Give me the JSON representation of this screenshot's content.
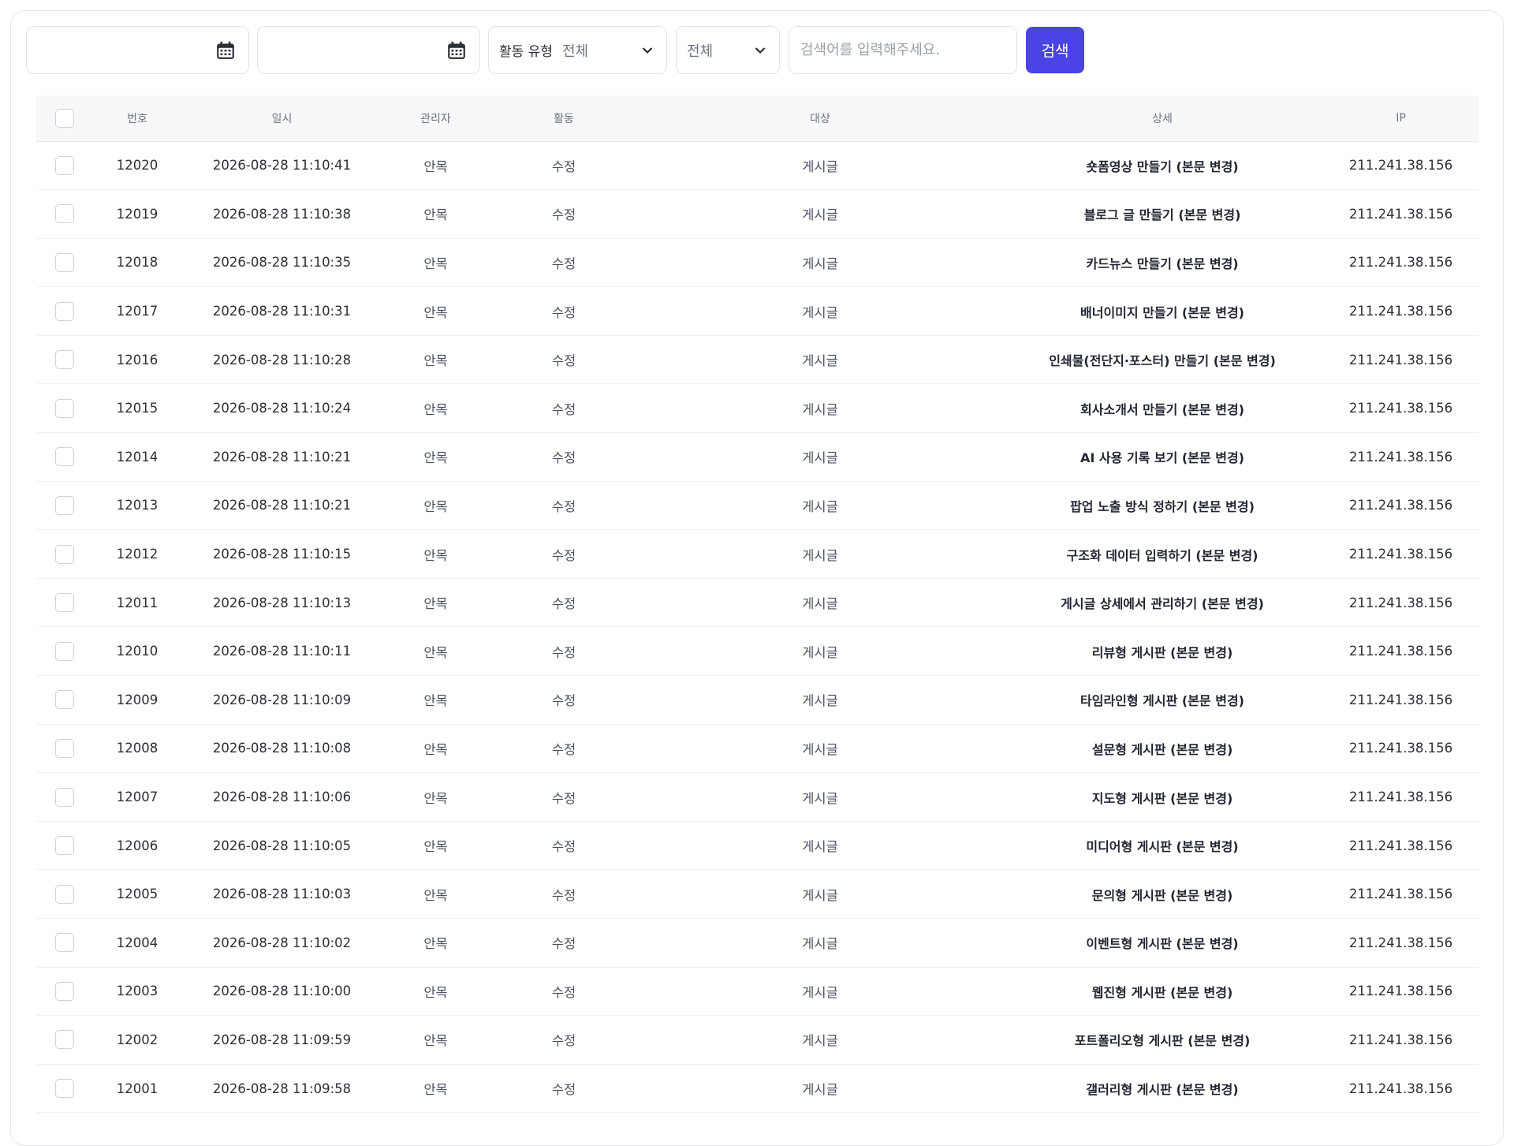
{
  "filters": {
    "start_date": "",
    "end_date": "",
    "calendar_icon": "calendar-icon",
    "activity_type_label": "활동 유형",
    "activity_type_value": "전체",
    "scope_value": "전체",
    "search_placeholder": "검색어를 입력해주세요.",
    "search_button": "검색",
    "accent_color": "#4a43e6"
  },
  "table": {
    "headers": {
      "number": "번호",
      "datetime": "일시",
      "admin": "관리자",
      "activity": "활동",
      "target": "대상",
      "detail": "상세",
      "ip": "IP"
    },
    "rows": [
      {
        "number": "12020",
        "datetime": "2026-08-28 11:10:41",
        "admin": "안목",
        "activity": "수정",
        "target": "게시글",
        "detail": "숏폼영상 만들기 (본문 변경)",
        "ip": "211.241.38.156"
      },
      {
        "number": "12019",
        "datetime": "2026-08-28 11:10:38",
        "admin": "안목",
        "activity": "수정",
        "target": "게시글",
        "detail": "블로그 글 만들기 (본문 변경)",
        "ip": "211.241.38.156"
      },
      {
        "number": "12018",
        "datetime": "2026-08-28 11:10:35",
        "admin": "안목",
        "activity": "수정",
        "target": "게시글",
        "detail": "카드뉴스 만들기 (본문 변경)",
        "ip": "211.241.38.156"
      },
      {
        "number": "12017",
        "datetime": "2026-08-28 11:10:31",
        "admin": "안목",
        "activity": "수정",
        "target": "게시글",
        "detail": "배너이미지 만들기 (본문 변경)",
        "ip": "211.241.38.156"
      },
      {
        "number": "12016",
        "datetime": "2026-08-28 11:10:28",
        "admin": "안목",
        "activity": "수정",
        "target": "게시글",
        "detail": "인쇄물(전단지·포스터) 만들기 (본문 변경)",
        "ip": "211.241.38.156"
      },
      {
        "number": "12015",
        "datetime": "2026-08-28 11:10:24",
        "admin": "안목",
        "activity": "수정",
        "target": "게시글",
        "detail": "회사소개서 만들기 (본문 변경)",
        "ip": "211.241.38.156"
      },
      {
        "number": "12014",
        "datetime": "2026-08-28 11:10:21",
        "admin": "안목",
        "activity": "수정",
        "target": "게시글",
        "detail": "AI 사용 기록 보기 (본문 변경)",
        "ip": "211.241.38.156"
      },
      {
        "number": "12013",
        "datetime": "2026-08-28 11:10:21",
        "admin": "안목",
        "activity": "수정",
        "target": "게시글",
        "detail": "팝업 노출 방식 정하기 (본문 변경)",
        "ip": "211.241.38.156"
      },
      {
        "number": "12012",
        "datetime": "2026-08-28 11:10:15",
        "admin": "안목",
        "activity": "수정",
        "target": "게시글",
        "detail": "구조화 데이터 입력하기 (본문 변경)",
        "ip": "211.241.38.156"
      },
      {
        "number": "12011",
        "datetime": "2026-08-28 11:10:13",
        "admin": "안목",
        "activity": "수정",
        "target": "게시글",
        "detail": "게시글 상세에서 관리하기 (본문 변경)",
        "ip": "211.241.38.156"
      },
      {
        "number": "12010",
        "datetime": "2026-08-28 11:10:11",
        "admin": "안목",
        "activity": "수정",
        "target": "게시글",
        "detail": "리뷰형 게시판 (본문 변경)",
        "ip": "211.241.38.156"
      },
      {
        "number": "12009",
        "datetime": "2026-08-28 11:10:09",
        "admin": "안목",
        "activity": "수정",
        "target": "게시글",
        "detail": "타임라인형 게시판 (본문 변경)",
        "ip": "211.241.38.156"
      },
      {
        "number": "12008",
        "datetime": "2026-08-28 11:10:08",
        "admin": "안목",
        "activity": "수정",
        "target": "게시글",
        "detail": "설문형 게시판 (본문 변경)",
        "ip": "211.241.38.156"
      },
      {
        "number": "12007",
        "datetime": "2026-08-28 11:10:06",
        "admin": "안목",
        "activity": "수정",
        "target": "게시글",
        "detail": "지도형 게시판 (본문 변경)",
        "ip": "211.241.38.156"
      },
      {
        "number": "12006",
        "datetime": "2026-08-28 11:10:05",
        "admin": "안목",
        "activity": "수정",
        "target": "게시글",
        "detail": "미디어형 게시판 (본문 변경)",
        "ip": "211.241.38.156"
      },
      {
        "number": "12005",
        "datetime": "2026-08-28 11:10:03",
        "admin": "안목",
        "activity": "수정",
        "target": "게시글",
        "detail": "문의형 게시판 (본문 변경)",
        "ip": "211.241.38.156"
      },
      {
        "number": "12004",
        "datetime": "2026-08-28 11:10:02",
        "admin": "안목",
        "activity": "수정",
        "target": "게시글",
        "detail": "이벤트형 게시판 (본문 변경)",
        "ip": "211.241.38.156"
      },
      {
        "number": "12003",
        "datetime": "2026-08-28 11:10:00",
        "admin": "안목",
        "activity": "수정",
        "target": "게시글",
        "detail": "웹진형 게시판 (본문 변경)",
        "ip": "211.241.38.156"
      },
      {
        "number": "12002",
        "datetime": "2026-08-28 11:09:59",
        "admin": "안목",
        "activity": "수정",
        "target": "게시글",
        "detail": "포트폴리오형 게시판 (본문 변경)",
        "ip": "211.241.38.156"
      },
      {
        "number": "12001",
        "datetime": "2026-08-28 11:09:58",
        "admin": "안목",
        "activity": "수정",
        "target": "게시글",
        "detail": "갤러리형 게시판 (본문 변경)",
        "ip": "211.241.38.156"
      }
    ]
  }
}
